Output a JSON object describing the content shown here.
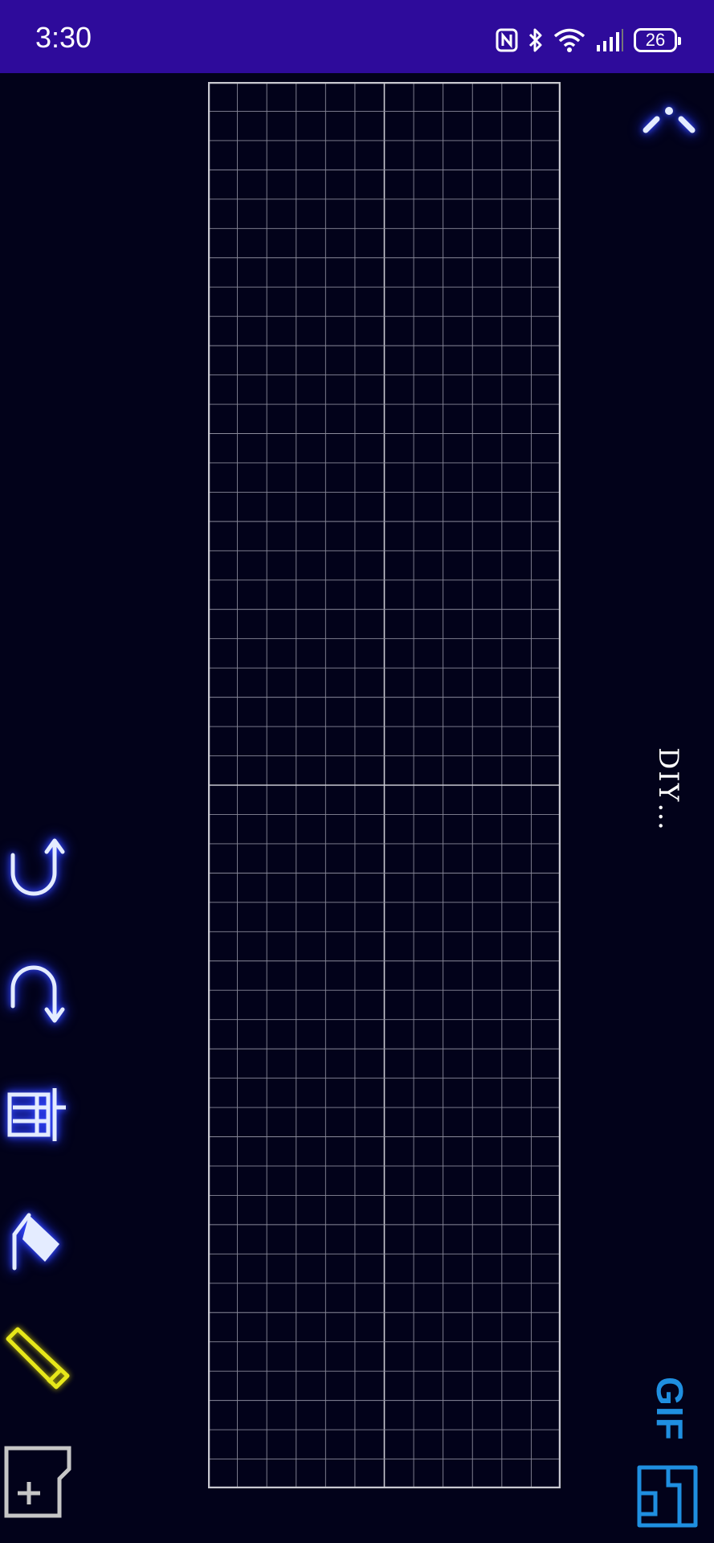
{
  "status_bar": {
    "time": "3:30",
    "battery": "26",
    "icons": [
      "nfc-icon",
      "bluetooth-icon",
      "wifi-icon",
      "cellular-signal-icon",
      "battery-icon"
    ],
    "background": "#2e0b9b"
  },
  "canvas": {
    "columns": 12,
    "rows": 48,
    "major_column_every": 6,
    "major_row_every": 24,
    "grid_line_color": "#8a8a9a",
    "border_color": "#c8c8d0"
  },
  "toolbar": {
    "tools": [
      "undo-icon",
      "redo-icon",
      "frames-icon",
      "eraser-icon",
      "pencil-icon",
      "add-frame-icon"
    ],
    "accent": "#3a4dff",
    "active_tool_color": "#e7e71a"
  },
  "side": {
    "collapse_icon": "chevron-up-icon",
    "diy_label": "DIY…",
    "gif_label": "GIF",
    "export_icon": "export-icon",
    "gif_color": "#1f8fe0"
  },
  "background": "#02021a"
}
